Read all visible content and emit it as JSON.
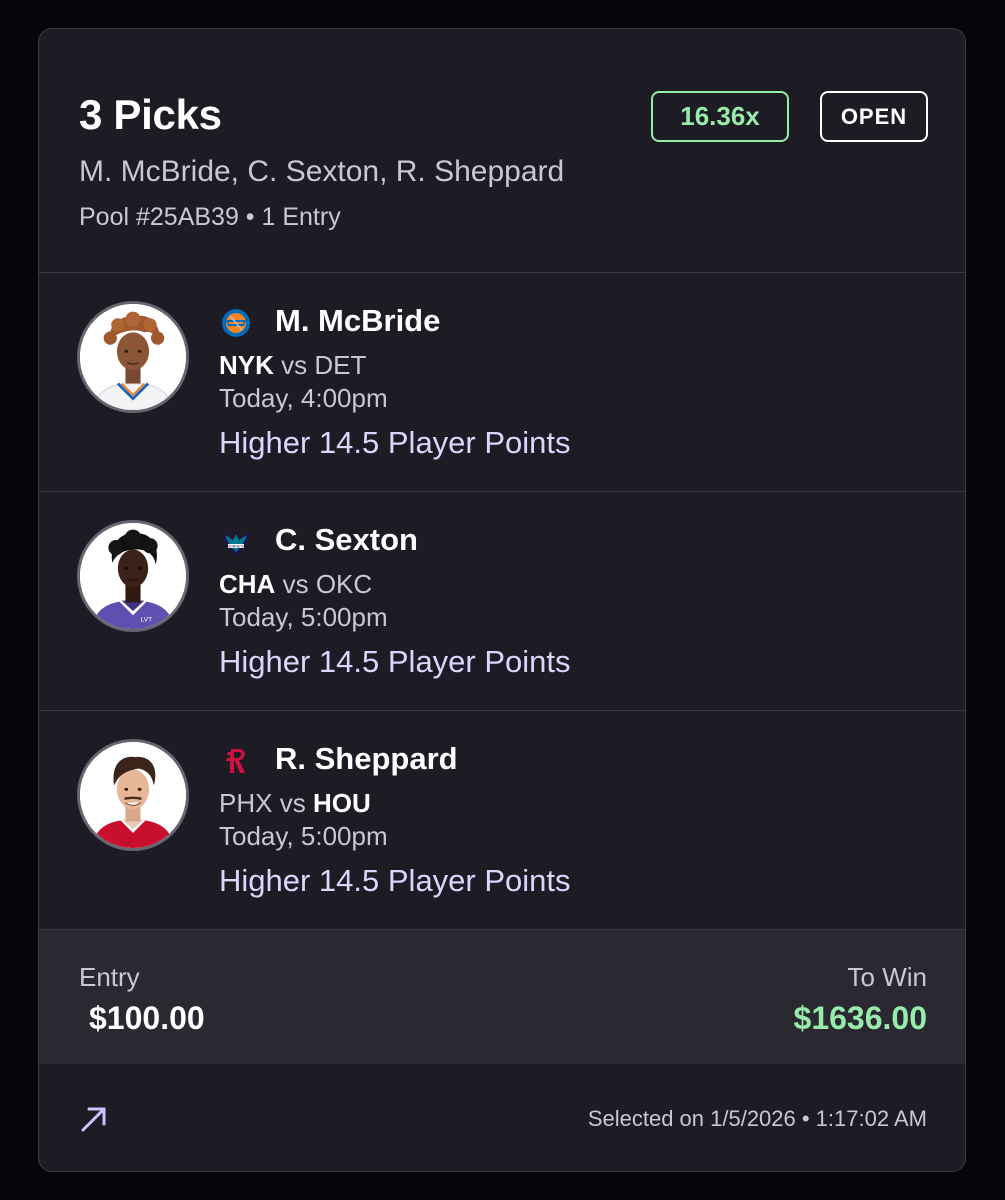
{
  "header": {
    "title": "3 Picks",
    "players": "M. McBride, C. Sexton, R. Sheppard",
    "pool": "Pool #25AB39 • 1 Entry",
    "multiplier": "16.36x",
    "status": "OPEN"
  },
  "picks": [
    {
      "name": "M. McBride",
      "team": "NYK",
      "vs": "vs",
      "opponent": "DET",
      "time": "Today, 4:00pm",
      "line": "Higher 14.5 Player Points",
      "team_logo": "knicks-logo-icon",
      "jersey_color": "#f3f3f6"
    },
    {
      "name": "C. Sexton",
      "team": "CHA",
      "vs": "vs",
      "opponent": "OKC",
      "time": "Today, 5:00pm",
      "line": "Higher 14.5 Player Points",
      "team_logo": "hornets-logo-icon",
      "jersey_color": "#5f4fb0"
    },
    {
      "name": "R. Sheppard",
      "team": "PHX",
      "vs": "vs",
      "opponent": "HOU",
      "time": "Today, 5:00pm",
      "line": "Higher 14.5 Player Points",
      "team_logo": "rockets-logo-icon",
      "jersey_color": "#c8102e"
    }
  ],
  "summary": {
    "entry_label": "Entry",
    "entry_value": "$100.00",
    "win_label": "To Win",
    "win_value": "$1636.00"
  },
  "footer": {
    "share_icon": "arrow-up-right-icon",
    "selected": "Selected on 1/5/2026 • 1:17:02 AM"
  },
  "colors": {
    "background": "#060509",
    "card": "#1d1b23",
    "summary_bg": "#2a2831",
    "accent_green": "#97ecab",
    "line_text": "#dcd6ff"
  }
}
